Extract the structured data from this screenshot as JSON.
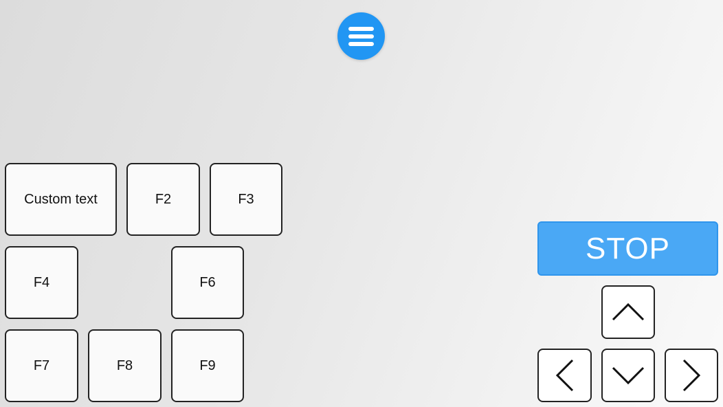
{
  "menu": {
    "icon": "hamburger-menu-icon",
    "color": "#2196f3"
  },
  "function_keys": [
    {
      "id": "custom",
      "label": "Custom text"
    },
    {
      "id": "f2",
      "label": "F2"
    },
    {
      "id": "f3",
      "label": "F3"
    },
    {
      "id": "f4",
      "label": "F4"
    },
    {
      "id": "f6",
      "label": "F6"
    },
    {
      "id": "f7",
      "label": "F7"
    },
    {
      "id": "f8",
      "label": "F8"
    },
    {
      "id": "f9",
      "label": "F9"
    }
  ],
  "stop_button": {
    "label": "STOP",
    "color": "#4aa8f5"
  },
  "arrows": {
    "up": "arrow-up-icon",
    "left": "arrow-left-icon",
    "down": "arrow-down-icon",
    "right": "arrow-right-icon"
  }
}
